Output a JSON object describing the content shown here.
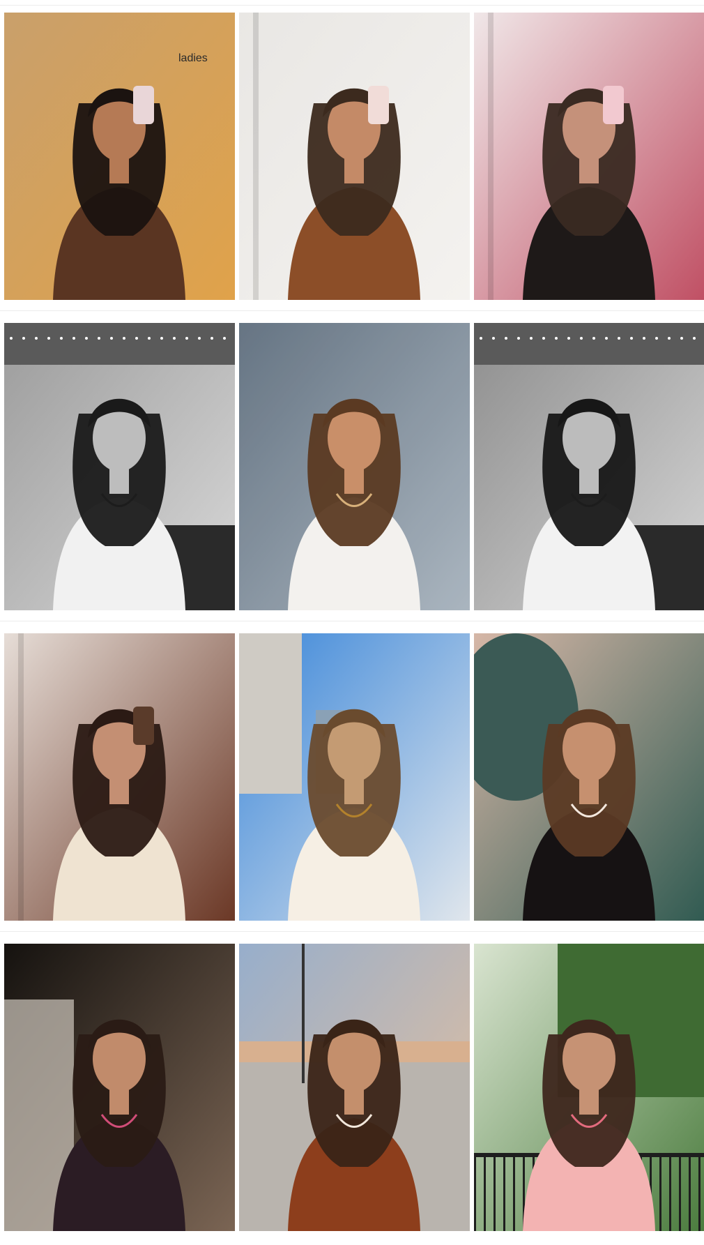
{
  "posts": [
    {
      "id": "post-1",
      "palette": {
        "bg1": "#c9a06b",
        "bg2": "#e0a24a",
        "person": "#5a3522",
        "accent": "#e9d6d8",
        "skin": "#b57a55",
        "hair": "#1b1310"
      },
      "scene": "selfie-pair",
      "text": "ladies"
    },
    {
      "id": "post-2",
      "palette": {
        "bg1": "#e9e7e4",
        "bg2": "#f4f2ef",
        "person": "#8c4e28",
        "accent": "#f1dcd8",
        "skin": "#c48a67",
        "hair": "#3c2a1e"
      },
      "scene": "mirror-selfie",
      "text": ""
    },
    {
      "id": "post-3",
      "palette": {
        "bg1": "#f0e7e8",
        "bg2": "#c05064",
        "person": "#1e1918",
        "accent": "#f2c9d0",
        "skin": "#c5917a",
        "hair": "#3a2a22"
      },
      "scene": "mirror-selfie",
      "text": ""
    },
    {
      "id": "post-4",
      "palette": {
        "bg1": "#9c9c9c",
        "bg2": "#d8d8d8",
        "person": "#f1f1f1",
        "accent": "#1c1c1c",
        "skin": "#bdbdbd",
        "hair": "#1a1a1a"
      },
      "scene": "bw-party",
      "text": ""
    },
    {
      "id": "post-5",
      "palette": {
        "bg1": "#6f7f8f",
        "bg2": "#b9c5d0",
        "person": "#f3f1ee",
        "accent": "#d8b07a",
        "skin": "#c98f69",
        "hair": "#5b3a22"
      },
      "scene": "portrait",
      "text": ""
    },
    {
      "id": "post-6",
      "palette": {
        "bg1": "#8e8e8e",
        "bg2": "#d5d5d5",
        "person": "#f2f2f2",
        "accent": "#1c1c1c",
        "skin": "#bcbcbc",
        "hair": "#171717"
      },
      "scene": "bw-party",
      "text": ""
    },
    {
      "id": "post-7",
      "palette": {
        "bg1": "#e6ddd7",
        "bg2": "#6b3826",
        "person": "#efe3d1",
        "accent": "#5a3b2a",
        "skin": "#c48f73",
        "hair": "#2b1a14"
      },
      "scene": "mirror-selfie",
      "text": ""
    },
    {
      "id": "post-8",
      "palette": {
        "bg1": "#3a86d9",
        "bg2": "#e0e6ec",
        "person": "#f6efe4",
        "accent": "#b3822c",
        "skin": "#c49b73",
        "hair": "#6a4b2e"
      },
      "scene": "street-selfie",
      "text": ""
    },
    {
      "id": "post-9",
      "palette": {
        "bg1": "#d6b7a7",
        "bg2": "#315b52",
        "person": "#161213",
        "accent": "#f4e8de",
        "skin": "#c6906f",
        "hair": "#5b3a24"
      },
      "scene": "crowd",
      "text": ""
    },
    {
      "id": "post-10",
      "palette": {
        "bg1": "#15120f",
        "bg2": "#7b6554",
        "person": "#2b1c24",
        "accent": "#d14d78",
        "skin": "#c18b6b",
        "hair": "#2a1b15"
      },
      "scene": "night-car",
      "text": ""
    },
    {
      "id": "post-11",
      "palette": {
        "bg1": "#97aecb",
        "bg2": "#e6c09d",
        "person": "#8d3e1c",
        "accent": "#f2e7db",
        "skin": "#c48f6c",
        "hair": "#3a2417"
      },
      "scene": "outdoor-parking",
      "text": ""
    },
    {
      "id": "post-12",
      "palette": {
        "bg1": "#d9e4d0",
        "bg2": "#4b7c3e",
        "person": "#f3b3b2",
        "accent": "#e46b7e",
        "skin": "#c69274",
        "hair": "#3e271d"
      },
      "scene": "garden-dress",
      "text": ""
    }
  ]
}
